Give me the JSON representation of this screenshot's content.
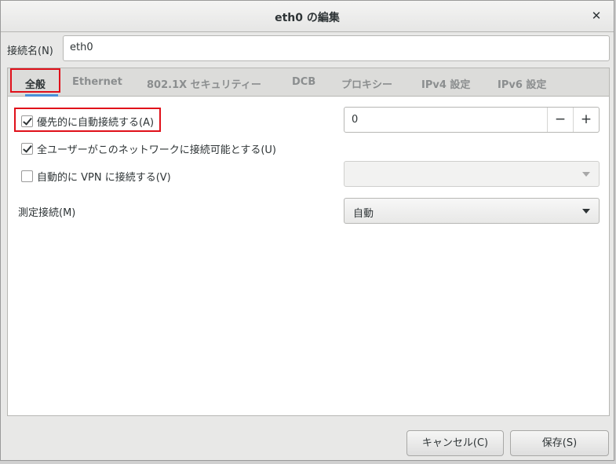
{
  "window": {
    "title": "eth0 の編集",
    "close_glyph": "✕"
  },
  "connection_name": {
    "label": "接続名(N)",
    "value": "eth0"
  },
  "tabs": [
    {
      "label": "全般",
      "active": true
    },
    {
      "label": "Ethernet",
      "active": false
    },
    {
      "label": "802.1X セキュリティー",
      "active": false
    },
    {
      "label": "DCB",
      "active": false
    },
    {
      "label": "プロキシー",
      "active": false
    },
    {
      "label": "IPv4 設定",
      "active": false
    },
    {
      "label": "IPv6 設定",
      "active": false
    }
  ],
  "general": {
    "auto_connect": {
      "label": "優先的に自動接続する(A)",
      "checked": true
    },
    "priority": {
      "value": "0",
      "minus": "−",
      "plus": "+"
    },
    "all_users": {
      "label": "全ユーザーがこのネットワークに接続可能とする(U)",
      "checked": true
    },
    "auto_vpn": {
      "label": "自動的に VPN に接続する(V)",
      "checked": false,
      "value": ""
    },
    "metered": {
      "label": "測定接続(M)",
      "value": "自動"
    }
  },
  "buttons": {
    "cancel": "キャンセル(C)",
    "save": "保存(S)"
  },
  "colors": {
    "highlight": "#e0101a",
    "active_tab_underline": "#4a90d9"
  }
}
